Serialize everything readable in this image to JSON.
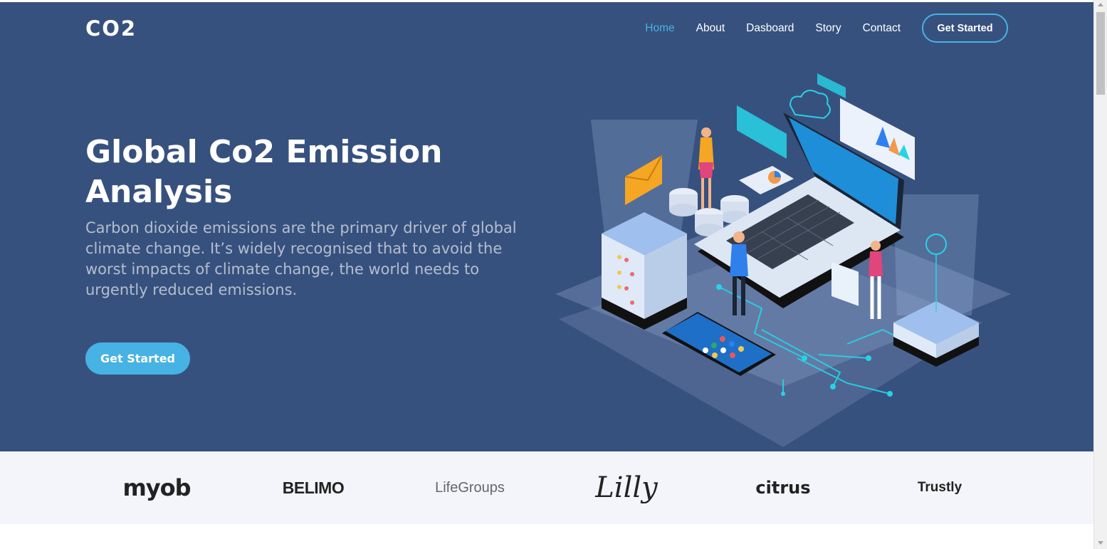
{
  "header": {
    "logo": "CO2",
    "nav": [
      {
        "label": "Home",
        "active": true
      },
      {
        "label": "About",
        "active": false
      },
      {
        "label": "Dasboard",
        "active": false
      },
      {
        "label": "Story",
        "active": false
      },
      {
        "label": "Contact",
        "active": false
      }
    ],
    "cta_label": "Get Started"
  },
  "hero": {
    "title": "Global Co2 Emission Analysis",
    "description": "Carbon dioxide emissions are the primary driver of global climate change. It’s widely recognised that to avoid the worst impacts of climate change, the world needs to urgently reduced emissions.",
    "button_label": "Get Started",
    "illustration_icon": "isometric-data-illustration"
  },
  "clients": [
    "myob",
    "BELIMO",
    "LifeGroups",
    "Lilly",
    "citrus",
    "Trustly"
  ],
  "colors": {
    "hero_bg": "#37517e",
    "accent": "#47b2e4",
    "clients_bg": "#f3f5fa"
  }
}
